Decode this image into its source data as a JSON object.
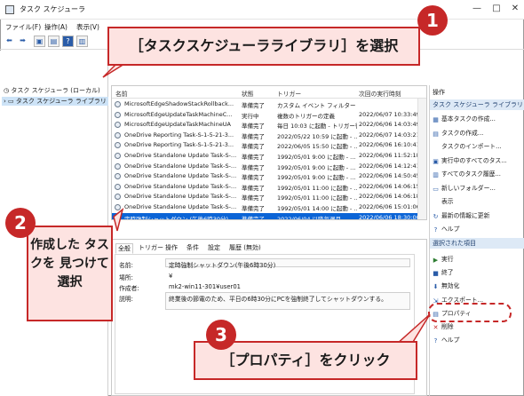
{
  "window": {
    "title": "タスク スケジューラ",
    "controls": [
      "—",
      "□",
      "✕"
    ]
  },
  "menu": [
    "ファイル(F)",
    "操作(A)",
    "表示(V)"
  ],
  "toolbar_icons": [
    "back-arrow-icon",
    "forward-arrow-icon",
    "folder-icon",
    "properties-icon",
    "help-icon",
    "console-icon"
  ],
  "tree": {
    "root": "タスク スケジューラ (ローカル)",
    "library": "タスク スケジューラ ライブラリ"
  },
  "task_list": {
    "columns": [
      "名前",
      "状態",
      "トリガー",
      "次回の実行時刻"
    ],
    "rows": [
      {
        "name": "MicrosoftEdgeShadowStackRollback...",
        "status": "準備完了",
        "trigger": "カスタム イベント フィルター",
        "next": ""
      },
      {
        "name": "MicrosoftEdgeUpdateTaskMachineC...",
        "status": "実行中",
        "trigger": "複数のトリガーの定義",
        "next": "2022/06/07 10:33:49"
      },
      {
        "name": "MicrosoftEdgeUpdateTaskMachineUA",
        "status": "準備完了",
        "trigger": "毎日 10:03 に起動 - トリガー後...",
        "next": "2022/06/06 14:03:49"
      },
      {
        "name": "OneDrive Reporting Task-S-1-5-21-3...",
        "status": "準備完了",
        "trigger": "2022/05/22 10:59 に起動 - ...",
        "next": "2022/06/07 14:03:21"
      },
      {
        "name": "OneDrive Reporting Task-S-1-5-21-3...",
        "status": "準備完了",
        "trigger": "2022/06/05 15:50 に起動 - ...",
        "next": "2022/06/06 16:10:41"
      },
      {
        "name": "OneDrive Standalone Update Task-S-...",
        "status": "準備完了",
        "trigger": "1992/05/01 9:00 に起動 - ...",
        "next": "2022/06/06 11:52:18"
      },
      {
        "name": "OneDrive Standalone Update Task-S-...",
        "status": "準備完了",
        "trigger": "1992/05/01 9:00 に起動 - ...",
        "next": "2022/06/06 14:12:41"
      },
      {
        "name": "OneDrive Standalone Update Task-S-...",
        "status": "準備完了",
        "trigger": "1992/05/01 9:00 に起動 - ...",
        "next": "2022/06/06 14:50:45"
      },
      {
        "name": "OneDrive Standalone Update Task-S-...",
        "status": "準備完了",
        "trigger": "1992/05/01 11:00 に起動 - ...",
        "next": "2022/06/06 14:06:15"
      },
      {
        "name": "OneDrive Standalone Update Task-S-...",
        "status": "準備完了",
        "trigger": "1992/05/01 11:00 に起動 - ...",
        "next": "2022/06/06 14:06:18"
      },
      {
        "name": "OneDrive Standalone Update Task-S-...",
        "status": "準備完了",
        "trigger": "1992/05/01 14:00 に起動 - ...",
        "next": "2022/06/06 15:01:06"
      },
      {
        "name": "定時強制シャットダウン (午後6時30分)",
        "status": "準備完了",
        "trigger": "2022/06/04 以降毎週月...",
        "next": "2022/06/06 18:30:00"
      }
    ],
    "selected_index": 11
  },
  "details": {
    "tabs": [
      "全般",
      "トリガー",
      "操作",
      "条件",
      "設定",
      "履歴 (無効)"
    ],
    "fields": [
      {
        "label": "名前:",
        "value": "定時強制シャットダウン(午後6時30分)"
      },
      {
        "label": "場所:",
        "value": "¥"
      },
      {
        "label": "作成者:",
        "value": "mk2-win11-301¥user01"
      },
      {
        "label": "説明:",
        "value": "終業後の節電のため、平日の6時30分にPCを強制終了してシャットダウンする。"
      }
    ]
  },
  "actions": {
    "header": "操作",
    "library_title": "タスク スケジューラ ライブラリ",
    "library_items": [
      {
        "icon": "basic-task-icon",
        "label": "基本タスクの作成..."
      },
      {
        "icon": "create-task-icon",
        "label": "タスクの作成..."
      },
      {
        "icon": "",
        "label": "タスクのインポート..."
      },
      {
        "icon": "running-tasks-icon",
        "label": "実行中のすべてのタス..."
      },
      {
        "icon": "history-icon",
        "label": "すべてのタスク履歴..."
      },
      {
        "icon": "new-folder-icon",
        "label": "新しいフォルダー..."
      },
      {
        "icon": "",
        "label": "表示"
      },
      {
        "icon": "refresh-icon",
        "label": "最新の情報に更新"
      },
      {
        "icon": "help-icon",
        "label": "ヘルプ"
      }
    ],
    "selected_title": "選択された項目",
    "selected_items": [
      {
        "icon": "run-icon",
        "label": "実行"
      },
      {
        "icon": "end-icon",
        "label": "終了"
      },
      {
        "icon": "disable-icon",
        "label": "無効化"
      },
      {
        "icon": "export-icon",
        "label": "エクスポート..."
      },
      {
        "icon": "properties-icon",
        "label": "プロパティ"
      },
      {
        "icon": "delete-icon",
        "label": "削除"
      },
      {
        "icon": "help-icon",
        "label": "ヘルプ"
      }
    ]
  },
  "callouts": {
    "step1": {
      "number": "1",
      "text": "［タスクスケジューラライブラリ］を選択"
    },
    "step2": {
      "number": "2",
      "text": "作成した タスクを 見つけて 選択"
    },
    "step3": {
      "number": "3",
      "text": "［プロパティ］をクリック"
    }
  },
  "colors": {
    "accent_red": "#c62828",
    "callout_fill": "#fde3e1",
    "selection_blue": "#0b64d6"
  }
}
